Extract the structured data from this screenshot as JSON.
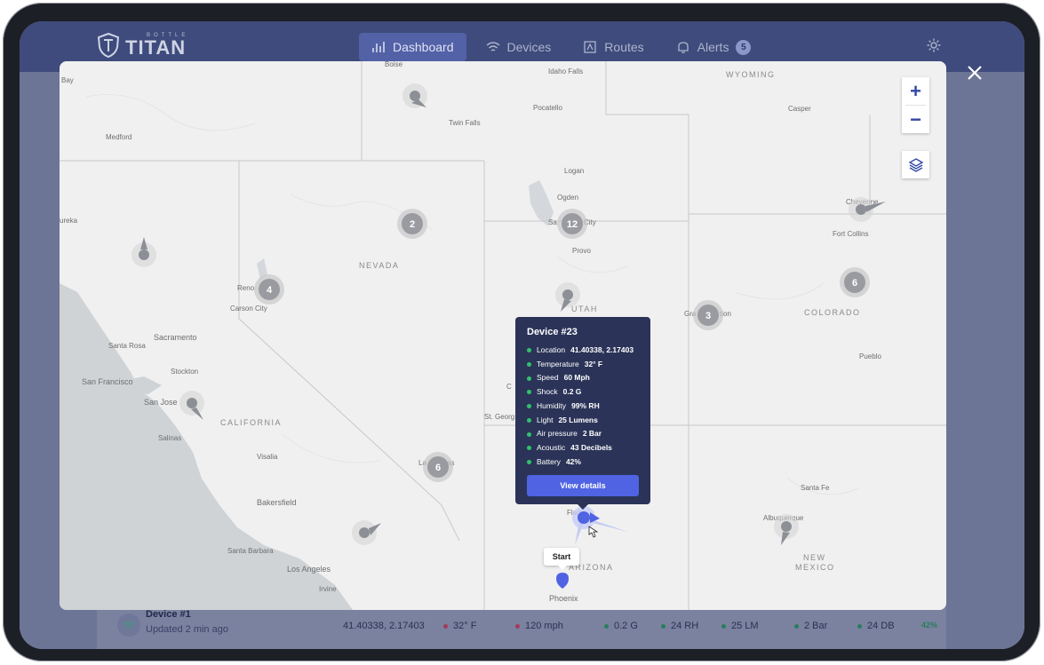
{
  "header": {
    "logo_small": "BOTTLE",
    "logo_big": "TITAN",
    "nav": [
      {
        "label": "Dashboard",
        "icon": "bar-chart-icon",
        "active": true
      },
      {
        "label": "Devices",
        "icon": "wifi-icon",
        "active": false
      },
      {
        "label": "Routes",
        "icon": "map-icon",
        "active": false
      },
      {
        "label": "Alerts",
        "icon": "bell-icon",
        "active": false,
        "badge": "5"
      }
    ]
  },
  "device_row": {
    "name": "Device #1",
    "updated": "Updated 2 min ago",
    "location": "41.40338, 2.17403",
    "temperature": "32° F",
    "speed": "120 mph",
    "shock": "0.2 G",
    "humidity": "24 RH",
    "light": "25 LM",
    "pressure": "2 Bar",
    "acoustic": "24 DB",
    "battery": "42%"
  },
  "map": {
    "places": {
      "boise": "Boise",
      "idaho_falls": "Idaho Falls",
      "wyoming": "WYOMING",
      "bay": "Bay",
      "pocatello": "Pocatello",
      "casper": "Casper",
      "twin_falls": "Twin Falls",
      "medford": "Medford",
      "logan": "Logan",
      "ogden": "Ogden",
      "salt_lake": "Sa",
      "salt_lake_tail": "City",
      "cheyenne": "Cheyenne",
      "eureka": "ureka",
      "fort_collins": "Fort Collins",
      "provo": "Provo",
      "nevada": "NEVADA",
      "reno": "Reno",
      "carson": "Carson City",
      "utah": "UTAH",
      "grand": "Gra",
      "grand_tail": "tion",
      "colorado": "COLORADO",
      "santa_rosa": "Santa Rosa",
      "sacramento": "Sacramento",
      "stockton": "Stockton",
      "sf": "San Francisco",
      "pueblo": "Pueblo",
      "san_jose": "San Jose",
      "california": "CALIFORNIA",
      "salinas": "Salinas",
      "st_george": "St. Georg",
      "visalia": "Visalia",
      "las_vegas": "La",
      "las_vegas_tail": "as",
      "c": "C",
      "santa_fe": "Santa Fe",
      "bakersfield": "Bakersfield",
      "flagstaff": "Flag",
      "albuquerque": "Albuquerque",
      "santa_barbara": "Santa Barbara",
      "arizona": "ARIZONA",
      "new_mexico_1": "NEW",
      "new_mexico_2": "MEXICO",
      "los_angeles": "Los Angeles",
      "irvine": "Irvine",
      "phoenix": "Phoenix"
    },
    "clusters": {
      "c1": "2",
      "c2": "12",
      "c3": "4",
      "c4": "6",
      "c5": "3",
      "c6": "6"
    },
    "start_label": "Start",
    "zoom_in": "+",
    "zoom_out": "−"
  },
  "popup": {
    "title": "Device #23",
    "items": [
      {
        "label": "Location",
        "value": "41.40338, 2.17403"
      },
      {
        "label": "Temperature",
        "value": "32° F"
      },
      {
        "label": "Speed",
        "value": "60 Mph"
      },
      {
        "label": "Shock",
        "value": "0.2 G"
      },
      {
        "label": "Humidity",
        "value": "99% RH"
      },
      {
        "label": "Light",
        "value": "25 Lumens"
      },
      {
        "label": "Air pressure",
        "value": "2 Bar"
      },
      {
        "label": "Acoustic",
        "value": "43 Decibels"
      },
      {
        "label": "Battery",
        "value": "42%"
      }
    ],
    "button": "View details"
  },
  "colors": {
    "accent": "#4f63e3",
    "popup_bg": "#2b3458",
    "status_green": "#2fc26b",
    "header": "#3e4b7c"
  }
}
